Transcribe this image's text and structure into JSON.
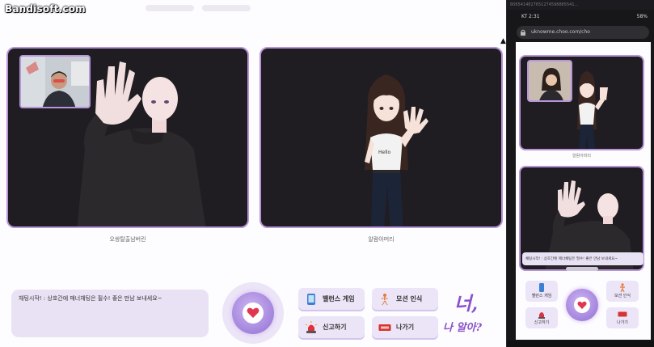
{
  "watermark": "Bandisoft.com",
  "call": {
    "remote_name": "오쌍탈출남버린",
    "local_name": "알람아머리",
    "chat_message": "채팅시작! : 상호간에 매너채팅은 필수! 좋은 만남 보내세요~"
  },
  "actions": {
    "balance_label": "밸런스 게임",
    "motion_label": "모션 인식",
    "report_label": "신고하기",
    "exit_label": "나가기"
  },
  "brand": {
    "line1": "너,",
    "line2": "나 알아?"
  },
  "phone": {
    "top_strip": "8065414827651274598865541...",
    "status_left": "KT 2:31",
    "status_right": "58%",
    "url": "uknowme.choo.com/cho",
    "video_name": "알람아머리",
    "chat_message": "채팅시작! : 상호간에 매너채팅은 필수! 좋은 만남 보내세요~",
    "balance_label": "밸런스 게임",
    "motion_label": "모션 인식",
    "report_label": "신고하기",
    "exit_label": "나가기"
  },
  "colors": {
    "accent": "#b895d8",
    "panel": "#ece4f7",
    "brand": "#8a52c8",
    "heart": "#e0364f"
  }
}
